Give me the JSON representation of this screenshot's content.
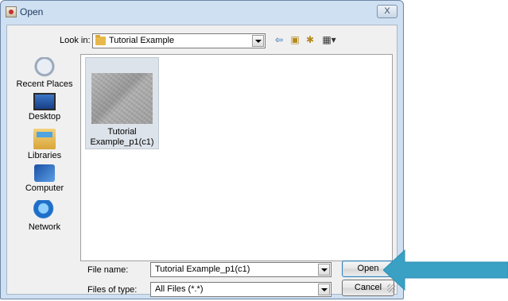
{
  "window": {
    "title": "Open",
    "close_label": "X"
  },
  "toolbar": {
    "look_in_label": "Look in:",
    "look_in_value": "Tutorial Example",
    "buttons": [
      "up-one-level",
      "home",
      "new-folder",
      "view-menu"
    ]
  },
  "places": [
    {
      "label": "Recent Places",
      "icon": "recent-places-icon"
    },
    {
      "label": "Desktop",
      "icon": "desktop-icon"
    },
    {
      "label": "Libraries",
      "icon": "libraries-icon"
    },
    {
      "label": "Computer",
      "icon": "computer-icon"
    },
    {
      "label": "Network",
      "icon": "network-icon"
    }
  ],
  "files": [
    {
      "label_line1": "Tutorial",
      "label_line2": "Example_p1(c1)"
    }
  ],
  "form": {
    "file_name_label": "File name:",
    "file_name_value": "Tutorial Example_p1(c1)",
    "files_of_type_label": "Files of type:",
    "files_of_type_value": "All Files (*.*)"
  },
  "buttons": {
    "open": "Open",
    "cancel": "Cancel"
  },
  "colors": {
    "pointer_arrow": "#3aa0c4",
    "title_bar": "#cfe0f2"
  }
}
